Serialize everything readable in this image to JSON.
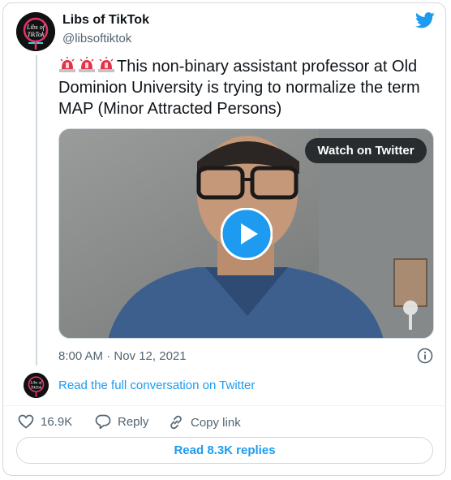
{
  "tweet": {
    "author_name": "Libs of TikTok",
    "author_handle": "@libsoftiktok",
    "avatar_text": "Libs of TikTok",
    "text": "This non-binary assistant professor at Old Dominion University is trying to normalize the term MAP (Minor Attracted Persons)",
    "emoji_prefix": [
      "siren-icon",
      "siren-icon",
      "siren-icon"
    ],
    "timestamp": "8:00 AM · Nov 12, 2021"
  },
  "media": {
    "watch_label": "Watch on Twitter",
    "play_icon": "play-icon"
  },
  "conversation": {
    "read_full_label": "Read the full conversation on Twitter"
  },
  "actions": {
    "like_count": "16.9K",
    "reply_label": "Reply",
    "copy_link_label": "Copy link"
  },
  "footer": {
    "read_replies_label": "Read 8.3K replies"
  },
  "colors": {
    "accent": "#1d9bf0",
    "muted": "#536471",
    "border": "#cfd9de"
  }
}
